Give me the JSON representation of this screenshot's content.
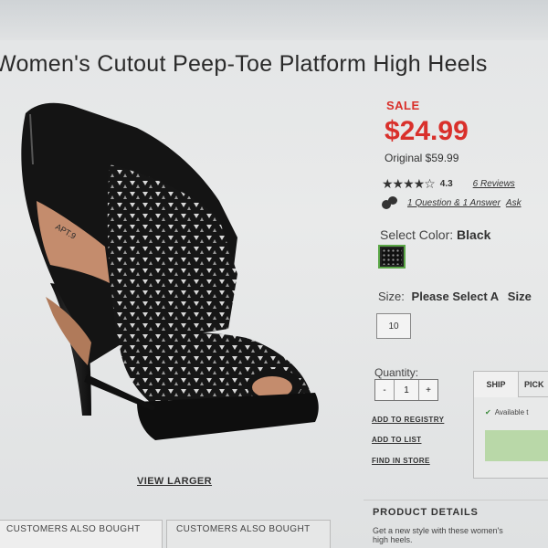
{
  "product": {
    "title": "Women's Cutout Peep-Toe Platform High Heels",
    "view_larger": "VIEW LARGER",
    "brand_mark": "APT.9"
  },
  "pricing": {
    "sale_label": "SALE",
    "price": "$24.99",
    "original": "Original $59.99"
  },
  "rating": {
    "stars": "★★★★☆",
    "value": "4.3",
    "reviews": "6 Reviews",
    "stars_value": 4.3
  },
  "qa": {
    "questions": "1 Question & 1 Answer",
    "ask": "Ask"
  },
  "color": {
    "label": "Select Color:",
    "value": "Black"
  },
  "size": {
    "label": "Size:",
    "prompt": "Please Select A",
    "chart": "Size",
    "options": [
      "10"
    ]
  },
  "quantity": {
    "label": "Quantity:",
    "minus": "-",
    "value": "1",
    "plus": "+"
  },
  "actions": {
    "registry": "ADD TO REGISTRY",
    "list": "ADD TO LIST",
    "store": "FIND IN STORE"
  },
  "fulfillment": {
    "ship_tab": "SHIP",
    "pickup_tab": "PICK",
    "availability": "Available t"
  },
  "details": {
    "title": "PRODUCT DETAILS",
    "line1": "Get a new style with these women's",
    "line2": "high heels."
  },
  "tabs": [
    "CUSTOMERS ALSO BOUGHT",
    "CUSTOMERS ALSO BOUGHT"
  ],
  "colors": {
    "sale_red": "#d9302b",
    "swatch_border": "#5aa646",
    "add_button": "#b9d8a8"
  }
}
